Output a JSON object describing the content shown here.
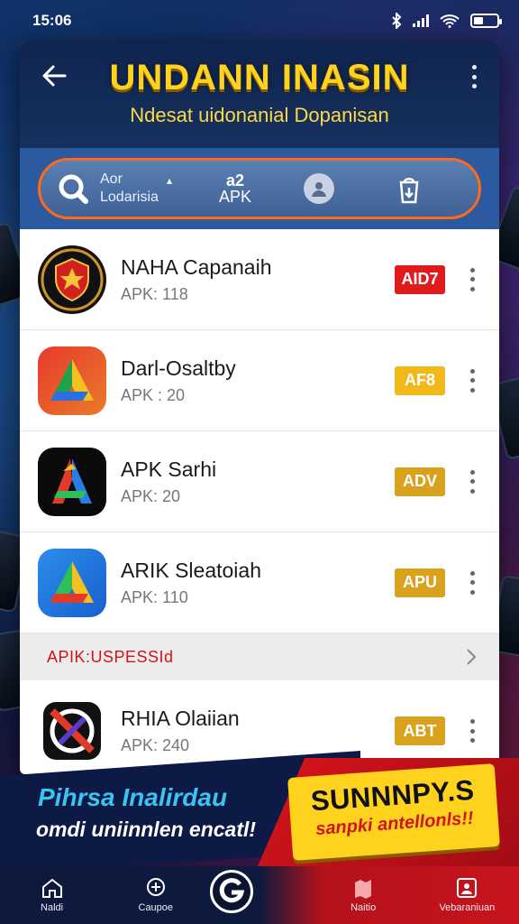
{
  "status_bar": {
    "time": "15:06"
  },
  "header": {
    "title": "UNDANN INASIN",
    "subtitle": "Ndesat uidonanial Dopanisan"
  },
  "search": {
    "line1": "Aor",
    "line2": "Lodarisia",
    "apk_count": "a2",
    "apk_label": "APK"
  },
  "apps": [
    {
      "name": "NAHA Capanaih",
      "sub": "APK: 118",
      "badge": "AID7",
      "badge_color": "#e01b1b",
      "icon": "shield-star-icon"
    },
    {
      "name": "Darl-Osaltby",
      "sub": "APK : 20",
      "badge": "AF8",
      "badge_color": "#f1b81a",
      "icon": "triangle-a-icon"
    },
    {
      "name": "APK Sarhi",
      "sub": "APK: 20",
      "badge": "ADV",
      "badge_color": "#d9a21c",
      "icon": "letter-a-icon"
    },
    {
      "name": "ARIK Sleatoiah",
      "sub": "APK: 110",
      "badge": "APU",
      "badge_color": "#d9a21c",
      "icon": "triangle-a-icon"
    }
  ],
  "section": {
    "label": "APIK:USPESSId"
  },
  "app_after_section": {
    "name": "RHIA Olaiian",
    "sub": "APK: 240",
    "badge": "ABT",
    "badge_color": "#d9a21c",
    "icon": "crossed-circle-icon"
  },
  "promo": {
    "title": "Pihrsa Inalirdau",
    "subtitle": "omdi uniinnlen encatl!",
    "brand": "SUNNNPY.S",
    "tagline": "sanpki antellonls!!"
  },
  "nav": {
    "items": [
      "Naldi",
      "Caupoe",
      "",
      "Naitio",
      "Vebaraniuan"
    ]
  }
}
